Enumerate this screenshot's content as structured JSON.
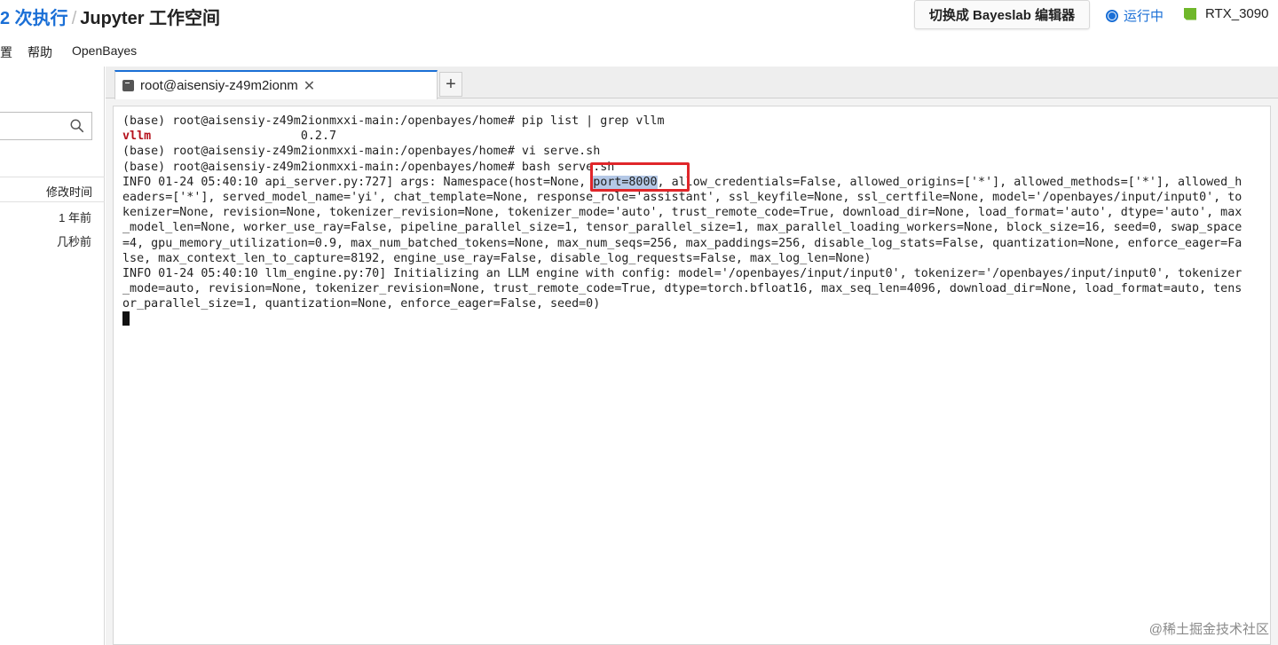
{
  "header": {
    "title_run": "2 次执行",
    "title_sep": "/",
    "title_workspace": "Jupyter 工作空间",
    "switch_button": "切换成 Bayeslab 编辑器",
    "status": "运行中",
    "gpu": "RTX_3090"
  },
  "menu": {
    "items": [
      "置",
      "帮助",
      "OpenBayes"
    ]
  },
  "sidebar": {
    "column_header": "修改时间",
    "rows": [
      "1 年前",
      "几秒前"
    ]
  },
  "tabs": {
    "active_label": "root@aisensiy-z49m2ionm",
    "close_glyph": "✕",
    "add_glyph": "+"
  },
  "terminal": {
    "l1": "(base) root@aisensiy-z49m2ionmxxi-main:/openbayes/home# pip list | grep vllm",
    "l2_pkg": "vllm",
    "l2_ver": "                     0.2.7",
    "l3": "(base) root@aisensiy-z49m2ionmxxi-main:/openbayes/home# vi serve.sh",
    "l4": "(base) root@aisensiy-z49m2ionmxxi-main:/openbayes/home# bash serve.sh",
    "l5_a": "INFO 01-24 05:40:10 api_server.py:727] args: Namespace(host=None, ",
    "l5_port": "port=8000",
    "l5_b": ", allow_credentials=False, allowed_origins=['*'], allowed_methods=['*'], allowed_h",
    "l6": "eaders=['*'], served_model_name='yi', chat_template=None, response_role='assistant', ssl_keyfile=None, ssl_certfile=None, model='/openbayes/input/input0', to",
    "l7": "kenizer=None, revision=None, tokenizer_revision=None, tokenizer_mode='auto', trust_remote_code=True, download_dir=None, load_format='auto', dtype='auto', max",
    "l8": "_model_len=None, worker_use_ray=False, pipeline_parallel_size=1, tensor_parallel_size=1, max_parallel_loading_workers=None, block_size=16, seed=0, swap_space",
    "l9": "=4, gpu_memory_utilization=0.9, max_num_batched_tokens=None, max_num_seqs=256, max_paddings=256, disable_log_stats=False, quantization=None, enforce_eager=Fa",
    "l10": "lse, max_context_len_to_capture=8192, engine_use_ray=False, disable_log_requests=False, max_log_len=None)",
    "l11": "INFO 01-24 05:40:10 llm_engine.py:70] Initializing an LLM engine with config: model='/openbayes/input/input0', tokenizer='/openbayes/input/input0', tokenizer",
    "l12": "_mode=auto, revision=None, tokenizer_revision=None, trust_remote_code=True, dtype=torch.bfloat16, max_seq_len=4096, download_dir=None, load_format=auto, tens",
    "l13": "or_parallel_size=1, quantization=None, enforce_eager=False, seed=0)"
  },
  "watermark": "@稀土掘金技术社区",
  "colors": {
    "accent": "#1a6fd6",
    "highlight_box": "#e0262a",
    "package_name": "#b5111c",
    "gpu_chip": "#6fb72a"
  }
}
